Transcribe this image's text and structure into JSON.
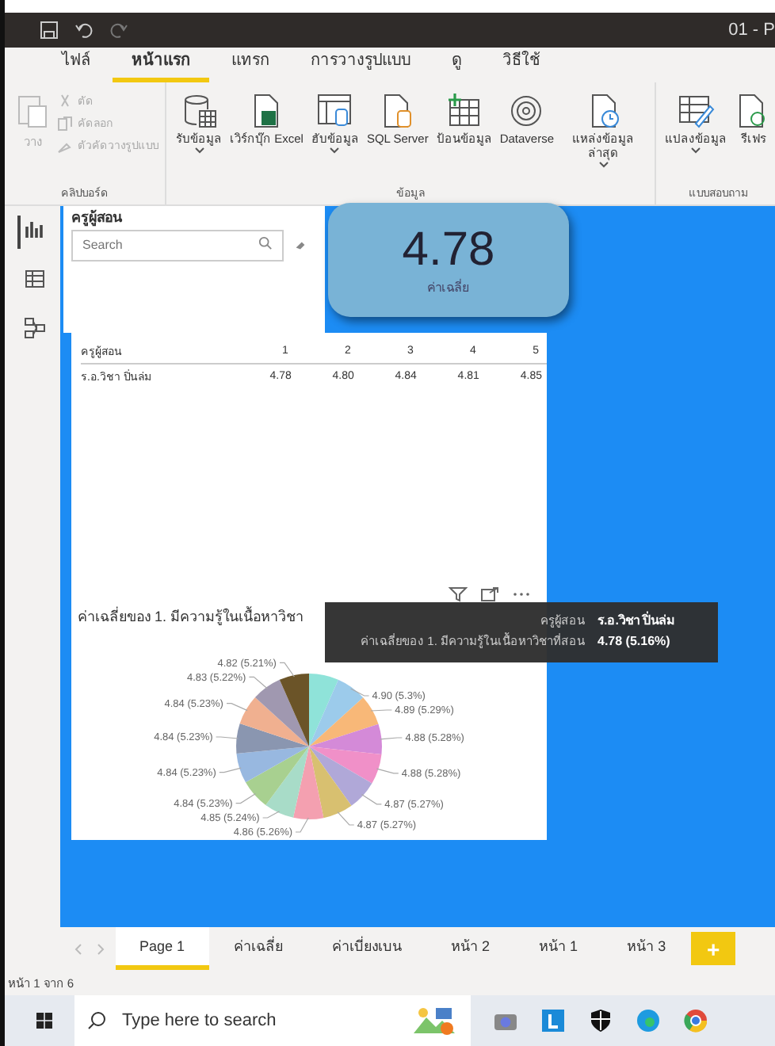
{
  "title_bar": {
    "title": "01 - P"
  },
  "menu_tabs": [
    {
      "label": "ไฟล์",
      "selected": false
    },
    {
      "label": "หน้าแรก",
      "selected": true
    },
    {
      "label": "แทรก",
      "selected": false
    },
    {
      "label": "การวางรูปแบบ",
      "selected": false
    },
    {
      "label": "ดู",
      "selected": false
    },
    {
      "label": "วิธีใช้",
      "selected": false
    }
  ],
  "clipboard": {
    "label": "คลิปบอร์ด",
    "paste": {
      "label": "วาง",
      "disabled": true
    },
    "items": [
      {
        "label": "ตัด",
        "disabled": true
      },
      {
        "label": "คัดลอก",
        "disabled": true
      },
      {
        "label": "ตัวคัดวางรูปแบบ",
        "disabled": true
      }
    ]
  },
  "data_group": {
    "label": "ข้อมูล",
    "items": [
      {
        "label": "รับข้อมูล",
        "dropdown": true
      },
      {
        "label": "เวิร์กบุ๊ก Excel",
        "dropdown": false
      },
      {
        "label": "ฮับข้อมูล",
        "dropdown": true
      },
      {
        "label": "SQL Server",
        "dropdown": false
      },
      {
        "label": "ป้อนข้อมูล",
        "dropdown": false
      },
      {
        "label": "Dataverse",
        "dropdown": false
      },
      {
        "label": "แหล่งข้อมูลล่าสุด",
        "dropdown": true
      }
    ]
  },
  "query_group": {
    "label": "แบบสอบถาม",
    "items": [
      {
        "label": "แปลงข้อมูล",
        "dropdown": true
      },
      {
        "label": "รีเฟร",
        "dropdown": false
      }
    ]
  },
  "view_rail": [
    {
      "selected": true
    },
    {
      "selected": false
    },
    {
      "selected": false
    }
  ],
  "slicer": {
    "title": "ครูผู้สอน",
    "placeholder": "Search"
  },
  "card": {
    "value": "4.78",
    "label": "ค่าเฉลี่ย"
  },
  "table": {
    "columns": [
      "ครูผู้สอน",
      "1",
      "2",
      "3",
      "4",
      "5"
    ],
    "rows": [
      [
        "ร.อ.วิชา ปิ่นล่ม",
        "4.78",
        "4.80",
        "4.84",
        "4.81",
        "4.85"
      ]
    ]
  },
  "pie_visual": {
    "title": "ค่าเฉลี่ยของ 1. มีความรู้ในเนื้อหาวิชา",
    "chart_data": {
      "type": "pie",
      "values": [
        4.78,
        4.9,
        4.89,
        4.88,
        4.88,
        4.87,
        4.87,
        4.86,
        4.85,
        4.84,
        4.84,
        4.84,
        4.84,
        4.83,
        4.82
      ],
      "value_labels": [
        null,
        "4.90 (5.3%)",
        "4.89 (5.29%)",
        "4.88 (5.28%)",
        "4.88 (5.28%)",
        "4.87 (5.27%)",
        "4.87 (5.27%)",
        "4.86 (5.26%)",
        "4.85 (5.24%)",
        "4.84 (5.23%)",
        "4.84 (5.23%)",
        "4.84 (5.23%)",
        "4.84 (5.23%)",
        "4.83 (5.22%)",
        "4.82 (5.21%)"
      ]
    }
  },
  "tooltip": [
    {
      "label": "ครูผู้สอน",
      "value": "ร.อ.วิชา ปิ่นล่ม"
    },
    {
      "label": "ค่าเฉลี่ยของ 1. มีความรู้ในเนื้อหาวิชาที่สอน",
      "value": "4.78 (5.16%)"
    }
  ],
  "page_tabs": [
    {
      "label": "Page 1",
      "selected": true
    },
    {
      "label": "ค่าเฉลี่ย",
      "selected": false
    },
    {
      "label": "ค่าเบี่ยงเบน",
      "selected": false
    },
    {
      "label": "หน้า 2",
      "selected": false
    },
    {
      "label": "หน้า 1",
      "selected": false
    },
    {
      "label": "หน้า 3",
      "selected": false
    }
  ],
  "add_page": "+",
  "status_bar": "หน้า 1 จาก 6",
  "taskbar": {
    "search_placeholder": "Type here to search"
  }
}
